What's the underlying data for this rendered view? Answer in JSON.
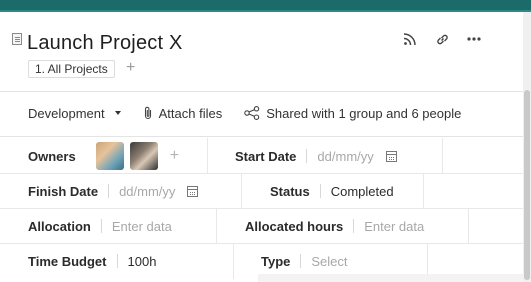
{
  "page": {
    "title": "Launch Project X",
    "breadcrumb": "1. All Projects",
    "add_breadcrumb_symbol": "+"
  },
  "header_icons": [
    "rss-icon",
    "link-icon",
    "more-icon"
  ],
  "toolbar": {
    "folder_label": "Development",
    "attach_label": "Attach files",
    "shared_label": "Shared with 1 group and 6 people"
  },
  "fields": {
    "owners_label": "Owners",
    "owners_add": "+",
    "start_date_label": "Start Date",
    "start_date_placeholder": "dd/mm/yy",
    "finish_date_label": "Finish Date",
    "finish_date_placeholder": "dd/mm/yy",
    "status_label": "Status",
    "status_value": "Completed",
    "allocation_label": "Allocation",
    "allocation_placeholder": "Enter data",
    "allocated_hours_label": "Allocated hours",
    "allocated_hours_placeholder": "Enter data",
    "time_budget_label": "Time Budget",
    "time_budget_value": "100h",
    "type_label": "Type",
    "type_placeholder": "Select"
  },
  "colors": {
    "topbar": "#1b6b6b",
    "placeholder": "#a8a8a8"
  }
}
